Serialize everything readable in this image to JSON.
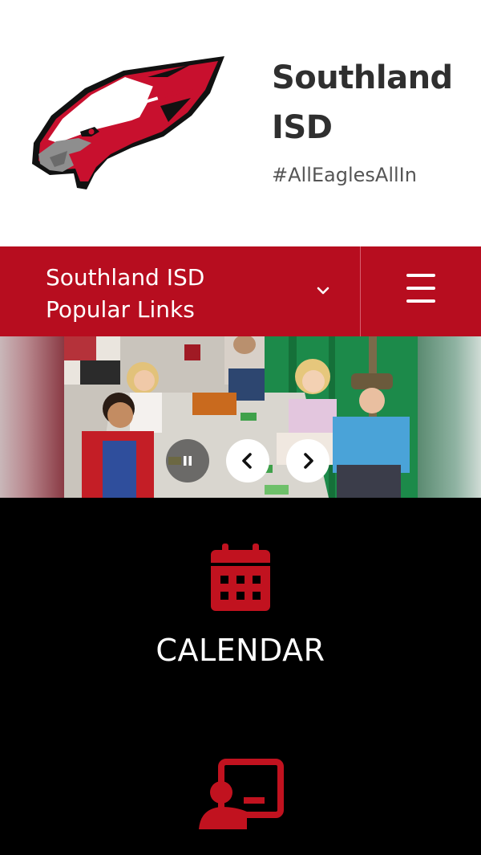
{
  "header": {
    "school_name": "Southland ISD",
    "tagline": "#AllEaglesAllIn",
    "logo_icon": "eagle-head-logo"
  },
  "navbar": {
    "dropdown_label": "Southland ISD Popular Links",
    "dropdown_icon": "chevron-down-icon",
    "menu_icon": "hamburger-menu-icon"
  },
  "slideshow": {
    "controls": {
      "pause_icon": "pause-icon",
      "prev_icon": "chevron-left-icon",
      "next_icon": "chevron-right-icon"
    }
  },
  "quick_links": [
    {
      "label": "CALENDAR",
      "icon": "calendar-icon"
    },
    {
      "label": "",
      "icon": "online-learning-icon"
    }
  ],
  "colors": {
    "brand_red": "#b70d1f",
    "icon_red": "#c1121f",
    "text_dark": "#2f2f2f",
    "links_bg": "#000000"
  }
}
